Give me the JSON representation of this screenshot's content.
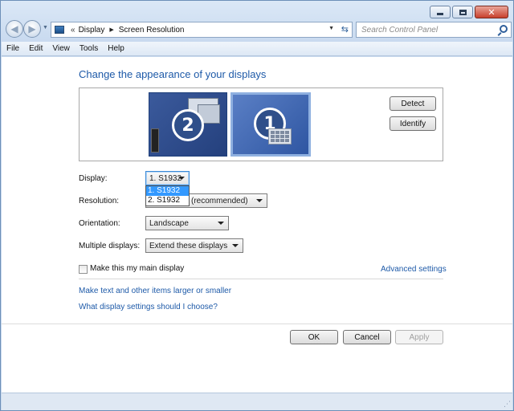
{
  "window": {
    "caption_buttons": {
      "minimize_icon": "minimize-icon",
      "maximize_icon": "maximize-icon",
      "close_icon": "close-icon",
      "close_glyph": "✕"
    }
  },
  "navbar": {
    "address": {
      "overflow": "«",
      "segments": [
        "Display",
        "Screen Resolution"
      ]
    },
    "search": {
      "placeholder": "Search Control Panel"
    }
  },
  "menu": [
    "File",
    "Edit",
    "View",
    "Tools",
    "Help"
  ],
  "main": {
    "heading": "Change the appearance of your displays",
    "monitors": [
      {
        "number": "2"
      },
      {
        "number": "1"
      }
    ],
    "detect_button": "Detect",
    "identify_button": "Identify",
    "display": {
      "label": "Display:",
      "selected": "1. S1932",
      "options": [
        "1. S1932",
        "2. S1932"
      ]
    },
    "resolution": {
      "label": "Resolution:",
      "value_visible": "(recommended)"
    },
    "orientation": {
      "label": "Orientation:",
      "value": "Landscape"
    },
    "multiple_displays": {
      "label": "Multiple displays:",
      "value": "Extend these displays"
    },
    "main_display_checkbox": {
      "label": "Make this my main display",
      "checked": false
    },
    "advanced_settings": "Advanced settings",
    "link_text_size": "Make text and other items larger or smaller",
    "link_help": "What display settings should I choose?",
    "ok_button": "OK",
    "cancel_button": "Cancel",
    "apply_button": "Apply"
  }
}
